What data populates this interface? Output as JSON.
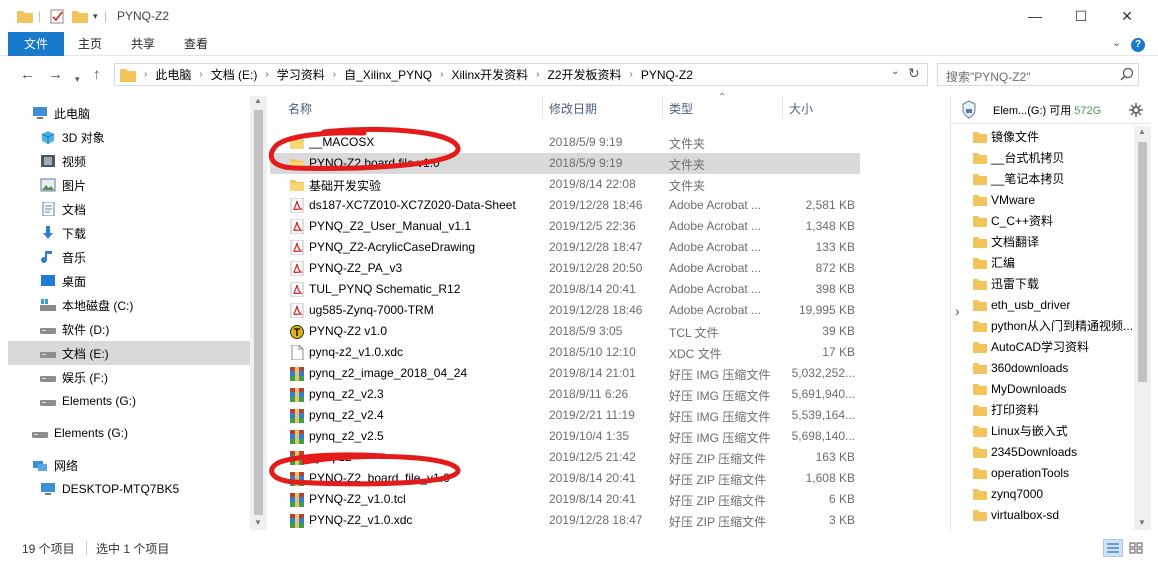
{
  "window": {
    "title": "PYNQ-Z2"
  },
  "window_controls": {
    "minimize": "—",
    "maximize": "☐",
    "close": "✕"
  },
  "ribbon": {
    "tabs": [
      "文件",
      "主页",
      "共享",
      "查看"
    ],
    "help": "?"
  },
  "address": {
    "crumbs": [
      "此电脑",
      "文档 (E:)",
      "学习资料",
      "自_Xilinx_PYNQ",
      "Xilinx开发资料",
      "Z2开发板资料",
      "PYNQ-Z2"
    ],
    "separator": "›"
  },
  "search": {
    "placeholder": "搜索\"PYNQ-Z2\""
  },
  "nav_pane": {
    "items": [
      {
        "label": "此电脑",
        "icon": "computer-icon"
      },
      {
        "label": "3D 对象",
        "icon": "3d-objects-icon"
      },
      {
        "label": "视频",
        "icon": "video-icon"
      },
      {
        "label": "图片",
        "icon": "pictures-icon"
      },
      {
        "label": "文档",
        "icon": "documents-icon"
      },
      {
        "label": "下载",
        "icon": "download-icon"
      },
      {
        "label": "音乐",
        "icon": "music-icon"
      },
      {
        "label": "桌面",
        "icon": "desktop-icon"
      },
      {
        "label": "本地磁盘 (C:)",
        "icon": "windows-drive-icon"
      },
      {
        "label": "软件 (D:)",
        "icon": "drive-icon"
      },
      {
        "label": "文档 (E:)",
        "icon": "drive-icon",
        "selected": true
      },
      {
        "label": "娱乐 (F:)",
        "icon": "drive-icon"
      },
      {
        "label": "Elements (G:)",
        "icon": "drive-icon"
      },
      {
        "label": "Elements (G:)",
        "icon": "drive-icon"
      },
      {
        "label": "网络",
        "icon": "network-icon"
      },
      {
        "label": "DESKTOP-MTQ7BK5",
        "icon": "computer-icon"
      }
    ]
  },
  "columns": {
    "name": "名称",
    "date": "修改日期",
    "type": "类型",
    "size": "大小"
  },
  "files": [
    {
      "name": "__MACOSX",
      "date": "2018/5/9 9:19",
      "type": "文件夹",
      "size": "",
      "icon": "folder"
    },
    {
      "name": "PYNQ-Z2 board file v1.0",
      "date": "2018/5/9 9:19",
      "type": "文件夹",
      "size": "",
      "icon": "folder",
      "selected": true
    },
    {
      "name": "基础开发实验",
      "date": "2019/8/14 22:08",
      "type": "文件夹",
      "size": "",
      "icon": "folder"
    },
    {
      "name": "ds187-XC7Z010-XC7Z020-Data-Sheet",
      "date": "2019/12/28 18:46",
      "type": "Adobe Acrobat ...",
      "size": "2,581 KB",
      "icon": "pdf"
    },
    {
      "name": "PYNQ_Z2_User_Manual_v1.1",
      "date": "2019/12/5 22:36",
      "type": "Adobe Acrobat ...",
      "size": "1,348 KB",
      "icon": "pdf"
    },
    {
      "name": "PYNQ_Z2-AcrylicCaseDrawing",
      "date": "2019/12/28 18:47",
      "type": "Adobe Acrobat ...",
      "size": "133 KB",
      "icon": "pdf"
    },
    {
      "name": "PYNQ-Z2_PA_v3",
      "date": "2019/12/28 20:50",
      "type": "Adobe Acrobat ...",
      "size": "872 KB",
      "icon": "pdf"
    },
    {
      "name": "TUL_PYNQ Schematic_R12",
      "date": "2019/8/14 20:41",
      "type": "Adobe Acrobat ...",
      "size": "398 KB",
      "icon": "pdf"
    },
    {
      "name": "ug585-Zynq-7000-TRM",
      "date": "2019/12/28 18:46",
      "type": "Adobe Acrobat ...",
      "size": "19,995 KB",
      "icon": "pdf"
    },
    {
      "name": "PYNQ-Z2 v1.0",
      "date": "2018/5/9 3:05",
      "type": "TCL 文件",
      "size": "39 KB",
      "icon": "tcl"
    },
    {
      "name": "pynq-z2_v1.0.xdc",
      "date": "2018/5/10 12:10",
      "type": "XDC 文件",
      "size": "17 KB",
      "icon": "file"
    },
    {
      "name": "pynq_z2_image_2018_04_24",
      "date": "2019/8/14 21:01",
      "type": "好压 IMG 压缩文件",
      "size": "5,032,252...",
      "icon": "archive"
    },
    {
      "name": "pynq_z2_v2.3",
      "date": "2018/9/11 6:26",
      "type": "好压 IMG 压缩文件",
      "size": "5,691,940...",
      "icon": "archive"
    },
    {
      "name": "pynq_z2_v2.4",
      "date": "2019/2/21 11:19",
      "type": "好压 IMG 压缩文件",
      "size": "5,539,164...",
      "icon": "archive"
    },
    {
      "name": "pynq_z2_v2.5",
      "date": "2019/10/4 1:35",
      "type": "好压 IMG 压缩文件",
      "size": "5,698,140...",
      "icon": "archive"
    },
    {
      "name": "pynq-z2",
      "date": "2019/12/5 21:42",
      "type": "好压 ZIP 压缩文件",
      "size": "163 KB",
      "icon": "archive"
    },
    {
      "name": "PYNQ-Z2_board_file_v1.0",
      "date": "2019/8/14 20:41",
      "type": "好压 ZIP 压缩文件",
      "size": "1,608 KB",
      "icon": "archive"
    },
    {
      "name": "PYNQ-Z2_v1.0.tcl",
      "date": "2019/8/14 20:41",
      "type": "好压 ZIP 压缩文件",
      "size": "6 KB",
      "icon": "archive"
    },
    {
      "name": "PYNQ-Z2_v1.0.xdc",
      "date": "2019/12/28 18:47",
      "type": "好压 ZIP 压缩文件",
      "size": "3 KB",
      "icon": "archive"
    }
  ],
  "preview_pane": {
    "drive_label": "Elem...(G:) 可用",
    "drive_free": "572G",
    "folders": [
      "镜像文件",
      "__台式机拷贝",
      "__笔记本拷贝",
      "VMware",
      "C_C++资料",
      "文档翻译",
      "汇编",
      "迅雷下载",
      "eth_usb_driver",
      "python从入门到精通视频...",
      "AutoCAD学习资料",
      "360downloads",
      "MyDownloads",
      "打印资料",
      "Linux与嵌入式",
      "2345Downloads",
      "operationTools",
      "zynq7000",
      "virtualbox-sd"
    ]
  },
  "status": {
    "count": "19 个项目",
    "selection": "选中 1 个项目"
  },
  "colors": {
    "accent": "#1979ca",
    "selection": "#d9d9d9",
    "annotation": "#e31b1b",
    "folder": "#f2c55c",
    "pdf": "#d8262a"
  }
}
